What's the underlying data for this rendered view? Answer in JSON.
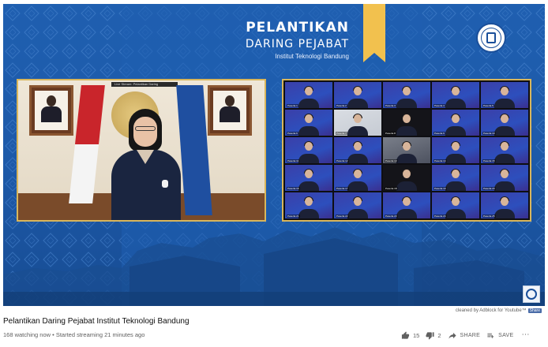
{
  "overlay": {
    "title_line1": "PELANTIKAN",
    "title_line2": "DARING PEJABAT",
    "title_line3": "Institut Teknologi Bandung",
    "speaker_screen_caption": "Live Stream: Pelantikan Daring"
  },
  "participants": [
    {
      "name": "Peserta 1",
      "style": "blue"
    },
    {
      "name": "Peserta 2",
      "style": "blue"
    },
    {
      "name": "Peserta 3",
      "style": "blue"
    },
    {
      "name": "Peserta 4",
      "style": "blue"
    },
    {
      "name": "Peserta 5",
      "style": "blue"
    },
    {
      "name": "Peserta 6",
      "style": "blue"
    },
    {
      "name": "Peserta 7",
      "style": "light"
    },
    {
      "name": "Peserta 8",
      "style": "dark"
    },
    {
      "name": "Peserta 9",
      "style": "blue"
    },
    {
      "name": "Peserta 10",
      "style": "blue"
    },
    {
      "name": "Peserta 11",
      "style": "blue"
    },
    {
      "name": "Peserta 12",
      "style": "blue"
    },
    {
      "name": "Peserta 13",
      "style": "room"
    },
    {
      "name": "Peserta 14",
      "style": "blue"
    },
    {
      "name": "Peserta 15",
      "style": "blue"
    },
    {
      "name": "Peserta 16",
      "style": "blue"
    },
    {
      "name": "Peserta 17",
      "style": "blue"
    },
    {
      "name": "Peserta 18",
      "style": "dark"
    },
    {
      "name": "Peserta 19",
      "style": "blue"
    },
    {
      "name": "Peserta 20",
      "style": "blue"
    },
    {
      "name": "Peserta 21",
      "style": "blue"
    },
    {
      "name": "Peserta 22",
      "style": "blue"
    },
    {
      "name": "Peserta 23",
      "style": "blue"
    },
    {
      "name": "Peserta 24",
      "style": "blue"
    },
    {
      "name": "Peserta 25",
      "style": "blue"
    }
  ],
  "adblock": {
    "text": "cleaned by Adblock for Youtube™",
    "share": "Share"
  },
  "video": {
    "title": "Pelantikan Daring Pejabat Institut Teknologi Bandung",
    "meta": "168 watching now • Started streaming 21 minutes ago",
    "likes": "15",
    "dislikes": "2",
    "share_label": "SHARE",
    "save_label": "SAVE",
    "more_label": "⋯"
  },
  "colors": {
    "background_blue": "#1f5fb0",
    "ribbon_gold": "#f2c14e",
    "panel_border": "#d9b65b"
  },
  "icons": [
    "like-icon",
    "dislike-icon",
    "share-icon",
    "save-icon",
    "more-icon",
    "itb-logo-icon"
  ]
}
